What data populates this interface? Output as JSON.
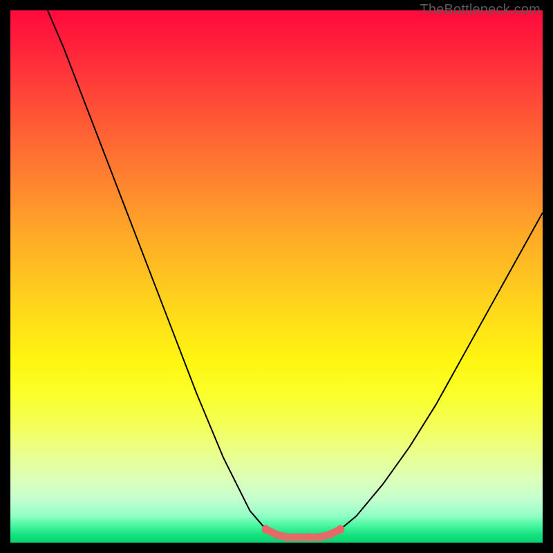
{
  "watermark": "TheBottleneck.com",
  "chart_data": {
    "type": "line",
    "title": "",
    "xlabel": "",
    "ylabel": "",
    "xlim": [
      0,
      100
    ],
    "ylim": [
      0,
      100
    ],
    "series": [
      {
        "name": "bottleneck-curve",
        "x": [
          7,
          10,
          15,
          20,
          25,
          30,
          35,
          40,
          45,
          48,
          50,
          52,
          54,
          56,
          58,
          60,
          62,
          65,
          70,
          75,
          80,
          85,
          90,
          95,
          100
        ],
        "values": [
          100,
          93,
          80,
          67,
          54,
          41,
          28,
          16,
          6,
          2.5,
          1.5,
          1,
          1,
          1,
          1,
          1.5,
          2.5,
          5,
          11,
          18,
          26,
          35,
          44,
          53,
          62
        ]
      },
      {
        "name": "optimal-range-marker",
        "x": [
          48,
          50,
          52,
          54,
          56,
          58,
          60,
          62
        ],
        "values": [
          2.5,
          1.5,
          1,
          1,
          1,
          1,
          1.5,
          2.5
        ]
      }
    ],
    "colors": {
      "curve": "#000000",
      "marker": "#e46a6a",
      "gradient_top": "#ff0a3c",
      "gradient_mid": "#ffe013",
      "gradient_bottom": "#08d46e"
    }
  }
}
